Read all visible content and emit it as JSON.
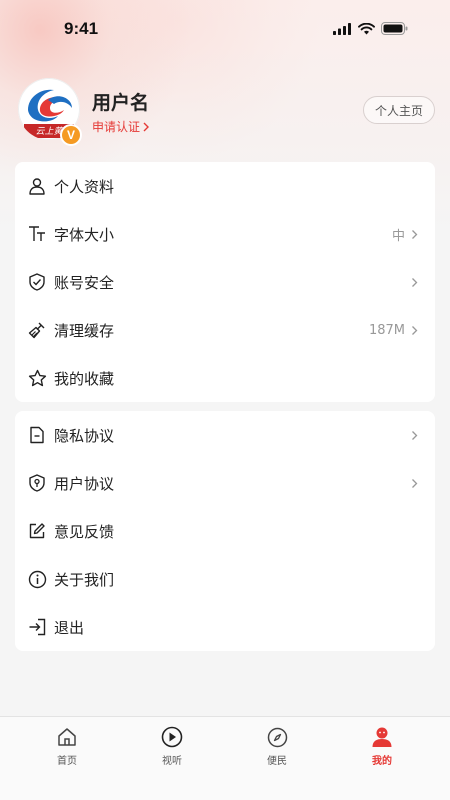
{
  "status_bar": {
    "time": "9:41"
  },
  "profile": {
    "username": "用户名",
    "apply_label": "申请认证",
    "homepage_label": "个人主页",
    "badge_letter": "V",
    "logo_text": "云上黄"
  },
  "menu_group_1": [
    {
      "label": "个人资料",
      "value": "",
      "icon": "user-icon",
      "chevron": false
    },
    {
      "label": "字体大小",
      "value": "中",
      "icon": "font-size-icon",
      "chevron": true
    },
    {
      "label": "账号安全",
      "value": "",
      "icon": "shield-check-icon",
      "chevron": true
    },
    {
      "label": "清理缓存",
      "value": "187M",
      "icon": "broom-icon",
      "chevron": true
    },
    {
      "label": "我的收藏",
      "value": "",
      "icon": "star-icon",
      "chevron": false
    }
  ],
  "menu_group_2": [
    {
      "label": "隐私协议",
      "value": "",
      "icon": "document-icon",
      "chevron": true
    },
    {
      "label": "用户协议",
      "value": "",
      "icon": "shield-user-icon",
      "chevron": true
    },
    {
      "label": "意见反馈",
      "value": "",
      "icon": "edit-icon",
      "chevron": false
    },
    {
      "label": "关于我们",
      "value": "",
      "icon": "info-icon",
      "chevron": false
    },
    {
      "label": "退出",
      "value": "",
      "icon": "logout-icon",
      "chevron": false
    }
  ],
  "tabbar": {
    "tabs": [
      {
        "label": "首页",
        "icon": "home-icon"
      },
      {
        "label": "视听",
        "icon": "play-icon"
      },
      {
        "label": "便民",
        "icon": "compass-icon"
      },
      {
        "label": "我的",
        "icon": "profile-icon"
      }
    ],
    "active_index": 3
  },
  "colors": {
    "accent": "#e53935",
    "badge": "#f59a23",
    "background": "#f5f5f5"
  }
}
